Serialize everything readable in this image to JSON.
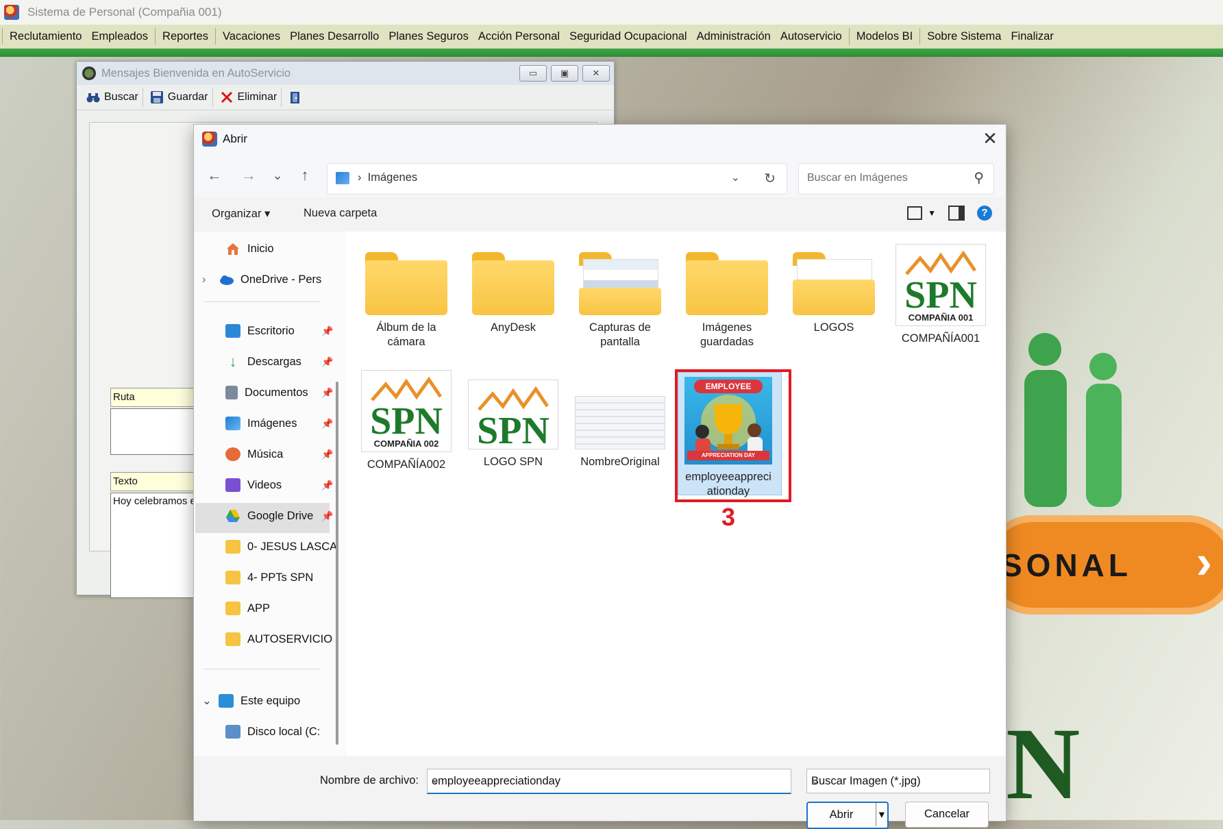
{
  "app": {
    "title": "Sistema de Personal (Compañia 001)",
    "menu": [
      "Reclutamiento",
      "Empleados",
      "Reportes",
      "Vacaciones",
      "Planes Desarrollo",
      "Planes Seguros",
      "Acción Personal",
      "Seguridad Ocupacional",
      "Administración",
      "Autoservicio",
      "Modelos BI",
      "Sobre Sistema",
      "Finalizar"
    ],
    "banner_text": "SONAL",
    "banner_chevron": "›",
    "bottom_letter": "N"
  },
  "back_window": {
    "title": "Mensajes Bienvenida en AutoServicio",
    "buttons": {
      "minimize": "▭",
      "restore": "▣",
      "close": "✕"
    },
    "toolbar": {
      "search": "Buscar",
      "save": "Guardar",
      "delete": "Eliminar"
    },
    "fields": {
      "ruta_label": "Ruta",
      "texto_label": "Texto",
      "texto_value": "Hoy celebramos el E"
    }
  },
  "dialog": {
    "title": "Abrir",
    "close": "✕",
    "nav": {
      "back": "←",
      "forward": "→",
      "recent": "⌄",
      "up": "↑"
    },
    "address": {
      "separator": "›",
      "location": "Imágenes"
    },
    "search_placeholder": "Buscar en Imágenes",
    "commands": {
      "organize": "Organizar ▾",
      "new_folder": "Nueva carpeta"
    },
    "help": "?",
    "nav_pane": {
      "home": "Inicio",
      "onedrive": "OneDrive - Pers",
      "quick": [
        {
          "label": "Escritorio",
          "color": "#2b88d8"
        },
        {
          "label": "Descargas",
          "color": "#2ea44f"
        },
        {
          "label": "Documentos",
          "color": "#7a8a9a"
        },
        {
          "label": "Imágenes",
          "color": "#1f7fd0"
        },
        {
          "label": "Música",
          "color": "#e56b3a"
        },
        {
          "label": "Videos",
          "color": "#7a4fd0"
        },
        {
          "label": "Google Drive",
          "color": "#34a853"
        },
        {
          "label": "0- JESUS LASCA",
          "color": "#f6c342"
        },
        {
          "label": "4- PPTs SPN",
          "color": "#f6c342"
        },
        {
          "label": "APP",
          "color": "#f6c342"
        },
        {
          "label": "AUTOSERVICIO",
          "color": "#f6c342"
        }
      ],
      "this_pc": "Este equipo",
      "partial": "Disco local (C:"
    },
    "files": [
      {
        "name": "Álbum de la cámara",
        "kind": "folder"
      },
      {
        "name": "AnyDesk",
        "kind": "folder"
      },
      {
        "name": "Capturas de pantalla",
        "kind": "folder-preview"
      },
      {
        "name": "Imágenes guardadas",
        "kind": "folder"
      },
      {
        "name": "LOGOS",
        "kind": "folder-paper"
      },
      {
        "name": "COMPAÑÍA001",
        "kind": "spn",
        "caption": "COMPAÑIA 001"
      },
      {
        "name": "COMPAÑÍA002",
        "kind": "spn",
        "caption": "COMPAÑIA 002"
      },
      {
        "name": "LOGO SPN",
        "kind": "spn",
        "caption": ""
      },
      {
        "name": "NombreOriginal",
        "kind": "screenshot"
      },
      {
        "name": "employeeappreciationday",
        "kind": "image",
        "selected": true,
        "badge_top": "EMPLOYEE",
        "badge_bottom": "APPRECIATION DAY"
      }
    ],
    "spn_logo": "SPN",
    "step_label": "3",
    "filename_label": "Nombre de archivo:",
    "filename_value": "employeeappreciationday",
    "filter": "Buscar Imagen (*.jpg)",
    "open_button": "Abrir",
    "split_arrow": "▾",
    "cancel_button": "Cancelar"
  }
}
